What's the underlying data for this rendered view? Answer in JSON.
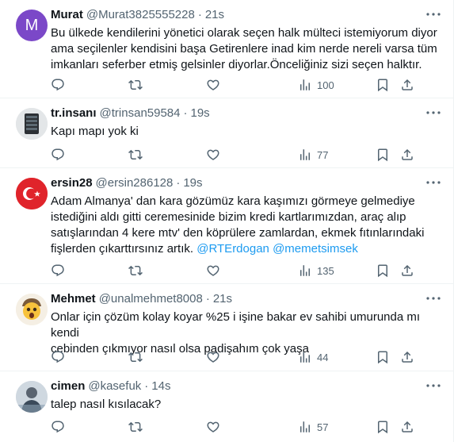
{
  "tweets": [
    {
      "name": "Murat",
      "handle": "@Murat3825555228",
      "time": "21s",
      "avatar_letter": "M",
      "text_lines": [
        "Bu ülkede kendilerini yönetici olarak seçen halk mülteci  istemiyorum diyor",
        "ama seçilenler kendisini başa Getirenlere inad  kim nerde  nereli varsa tüm",
        "imkanları seferber etmiş gelsinler diyorlar.Önceliğiniz sizi seçen halktır."
      ],
      "views": "100"
    },
    {
      "name": "tr.insanı",
      "handle": "@trinsan59584",
      "time": "19s",
      "text_lines": [
        "Kapı mapı yok ki"
      ],
      "views": "77"
    },
    {
      "name": "ersin28",
      "handle": "@ersin286128",
      "time": "19s",
      "text_lines": [
        "Adam Almanya' dan kara gözümüz kara kaşımızı görmeye gelmediye",
        "istediğini aldı gitti ceremesinide bizim kredi kartlarımızdan, araç alıp",
        "satışlarından 4 kere mtv' den köprülere zamlardan, ekmek fıtınlarındaki"
      ],
      "text_last": "fişlerden çıkarttırsınız artık.",
      "mentions": [
        "@RTErdogan",
        "@memetsimsek"
      ],
      "views": "135"
    },
    {
      "name": "Mehmet",
      "handle": "@unalmehmet8008",
      "time": "21s",
      "text_lines": [
        "Onlar için çözüm kolay koyar %25 i işine bakar ev sahibi umurunda mı kendi",
        "cebinden çıkmıyor nasıl olsa padişahım çok yaşa"
      ],
      "views": "44"
    },
    {
      "name": "cimen",
      "handle": "@kasefuk",
      "time": "14s",
      "text_lines": [
        "talep nasıl kısılacak?"
      ],
      "views": "57"
    }
  ],
  "separator": "·",
  "colors": {
    "text": "#0f1419",
    "secondary": "#536471",
    "link": "#1d9bf0",
    "border": "#eff3f4"
  },
  "icons": [
    "reply-icon",
    "retweet-icon",
    "like-icon",
    "views-icon",
    "bookmark-icon",
    "share-icon",
    "more-icon"
  ]
}
